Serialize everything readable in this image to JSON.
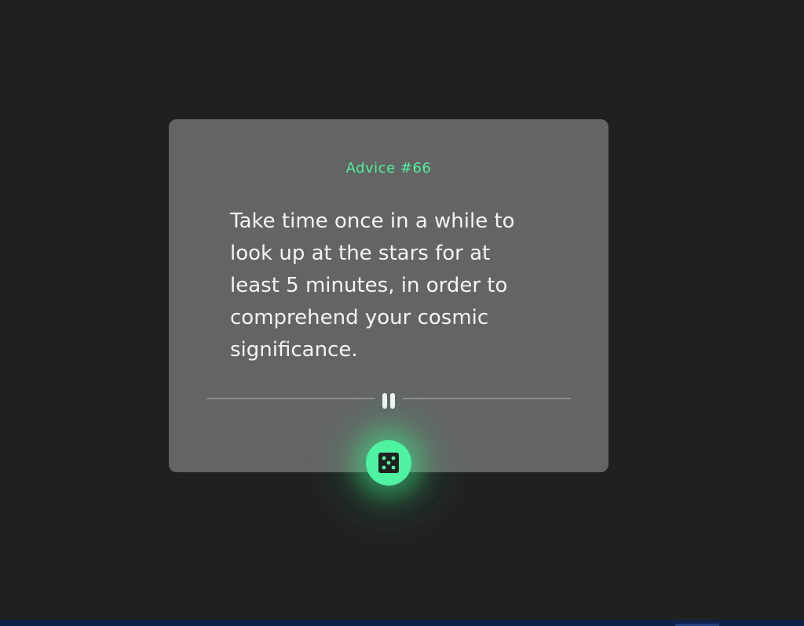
{
  "card": {
    "advice_number": "Advice #66",
    "advice_text": "Take time once in a while to look up at the stars for at least 5 minutes, in order to comprehend your cosmic significance."
  },
  "icons": {
    "divider": "pause-icon",
    "button": "dice-icon"
  },
  "colors": {
    "background": "#202020",
    "card": "#646464",
    "accent": "#4ef2a0",
    "text": "#f4f4f4"
  }
}
